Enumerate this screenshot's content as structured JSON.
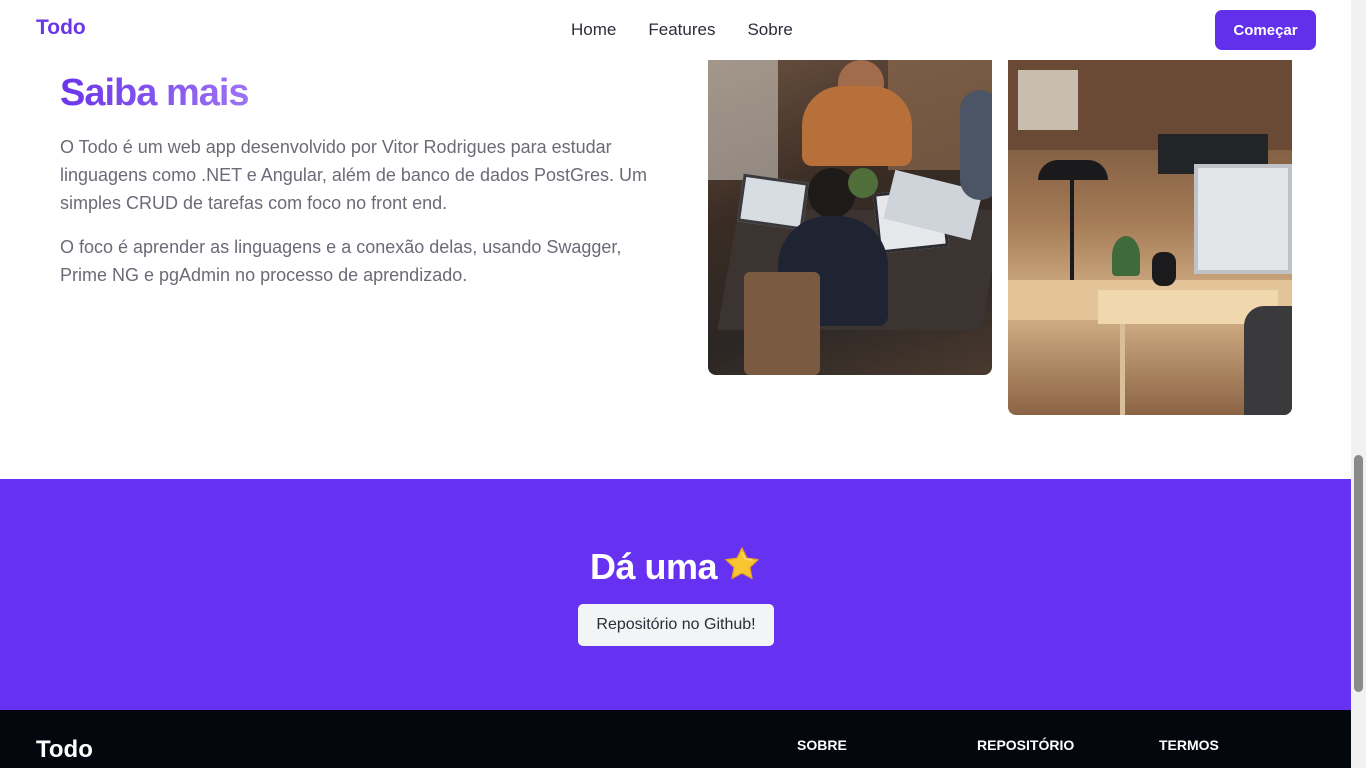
{
  "header": {
    "brand": "Todo",
    "nav": [
      "Home",
      "Features",
      "Sobre"
    ],
    "cta_label": "Começar"
  },
  "about": {
    "title": "Saiba mais",
    "paragraph1": "O Todo é um web app desenvolvido por Vitor Rodrigues para estudar linguagens como .NET e Angular, além de banco de dados PostGres. Um simples CRUD de tarefas com foco no front end.",
    "paragraph2": "O foco é aprender as linguagens e a conexão delas, usando Swagger, Prime NG e pgAdmin no processo de aprendizado.",
    "images": [
      "people-working-on-laptops-photo",
      "office-workspace-photo"
    ]
  },
  "cta_band": {
    "title": "Dá uma",
    "icon": "star-icon",
    "button_label": "Repositório no Github!",
    "background": "#6631f0"
  },
  "footer": {
    "brand": "Todo",
    "columns": [
      "SOBRE",
      "REPOSITÓRIO",
      "TERMOS"
    ],
    "background": "#05070f"
  },
  "colors": {
    "accent": "#6230eb",
    "text_muted": "#6b6b78"
  }
}
